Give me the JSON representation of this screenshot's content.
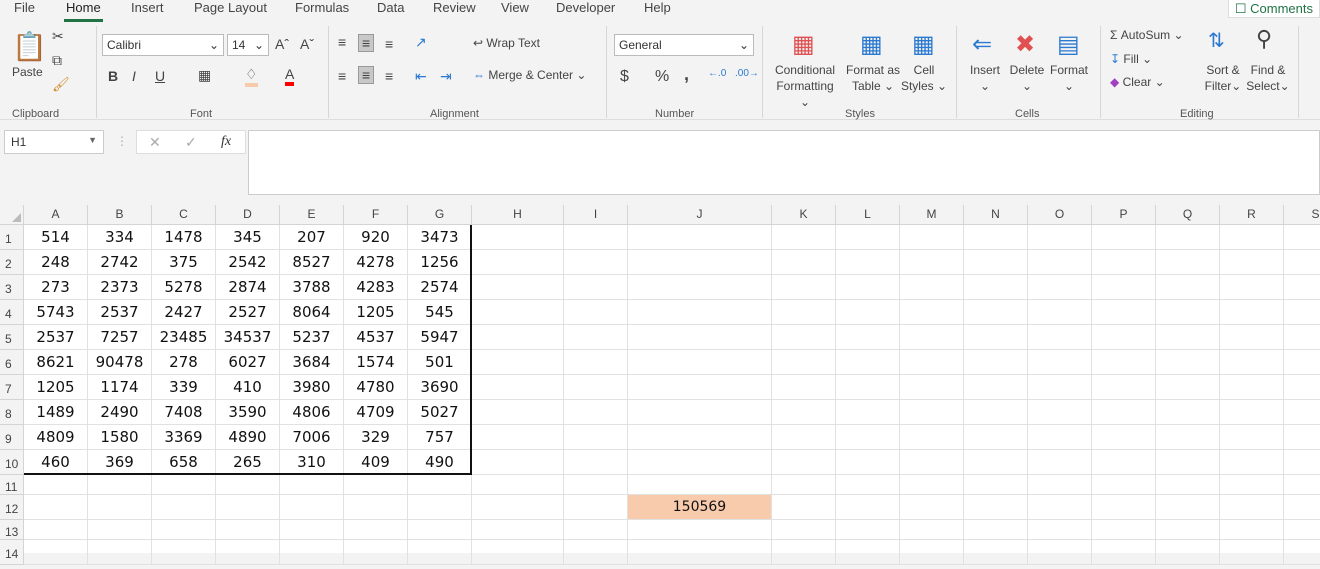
{
  "menu": {
    "tabs": [
      "File",
      "Home",
      "Insert",
      "Page Layout",
      "Formulas",
      "Data",
      "Review",
      "View",
      "Developer",
      "Help"
    ],
    "active": "Home",
    "comments": "Comments"
  },
  "ribbon": {
    "clipboard": {
      "paste": "Paste",
      "group": "Clipboard"
    },
    "font": {
      "name": "Calibri",
      "size": "14",
      "bold": "B",
      "italic": "I",
      "underline": "U",
      "group": "Font",
      "fill_color": "#f8cbad",
      "font_color": "#ff0000"
    },
    "alignment": {
      "wrap": "Wrap Text",
      "merge": "Merge & Center",
      "group": "Alignment"
    },
    "number": {
      "format": "General",
      "currency": "$",
      "percent": "%",
      "comma": ",",
      "group": "Number"
    },
    "styles": {
      "conditional": [
        "Conditional",
        "Formatting"
      ],
      "table": [
        "Format as",
        "Table"
      ],
      "cell": [
        "Cell",
        "Styles"
      ],
      "group": "Styles"
    },
    "cells": {
      "insert": "Insert",
      "delete": "Delete",
      "format": "Format",
      "group": "Cells"
    },
    "editing": {
      "autosum": "AutoSum",
      "fill": "Fill",
      "clear": "Clear",
      "sort": [
        "Sort &",
        "Filter"
      ],
      "find": [
        "Find &",
        "Select"
      ],
      "group": "Editing"
    }
  },
  "formula_bar": {
    "name_box": "H1",
    "fx": "fx",
    "formula": ""
  },
  "sheet": {
    "columns": [
      "A",
      "B",
      "C",
      "D",
      "E",
      "F",
      "G",
      "H",
      "I",
      "J",
      "K",
      "L",
      "M",
      "N",
      "O",
      "P",
      "Q",
      "R",
      "S"
    ],
    "rows": [
      "1",
      "2",
      "3",
      "4",
      "5",
      "6",
      "7",
      "8",
      "9",
      "10",
      "11",
      "12",
      "13",
      "14"
    ],
    "data": [
      [
        514,
        334,
        1478,
        345,
        207,
        920,
        3473
      ],
      [
        248,
        2742,
        375,
        2542,
        8527,
        4278,
        1256
      ],
      [
        273,
        2373,
        5278,
        2874,
        3788,
        4283,
        2574
      ],
      [
        5743,
        2537,
        2427,
        2527,
        8064,
        1205,
        545
      ],
      [
        2537,
        7257,
        23485,
        34537,
        5237,
        4537,
        5947
      ],
      [
        8621,
        90478,
        278,
        6027,
        3684,
        1574,
        501
      ],
      [
        1205,
        1174,
        339,
        410,
        3980,
        4780,
        3690
      ],
      [
        1489,
        2490,
        7408,
        3590,
        4806,
        4709,
        5027
      ],
      [
        4809,
        1580,
        3369,
        4890,
        7006,
        329,
        757
      ],
      [
        460,
        369,
        658,
        265,
        310,
        409,
        490
      ]
    ],
    "result_cell": {
      "ref": "J12",
      "value": "150569",
      "fill": "#f8cbad"
    }
  }
}
